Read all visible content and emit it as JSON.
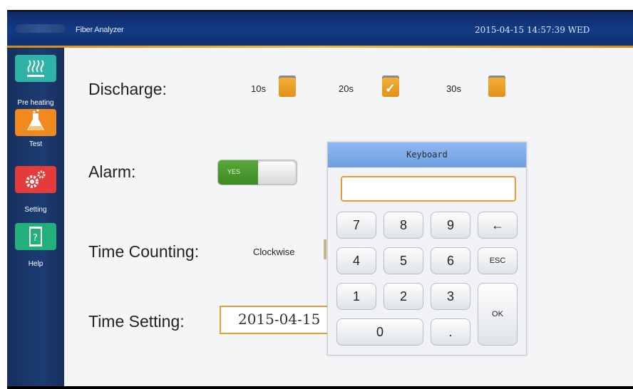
{
  "header": {
    "app_title": "Fiber Analyzer",
    "datetime": "2015-04-15  14:57:39  WED"
  },
  "sidebar": {
    "items": [
      {
        "label": "Pre heating",
        "icon": "heater-icon",
        "color": "#2fb3a7"
      },
      {
        "label": "Test",
        "icon": "flask-icon",
        "color": "#f08a1e"
      },
      {
        "label": "Setting",
        "icon": "gear-icon",
        "color": "#e53b3b"
      },
      {
        "label": "Help",
        "icon": "help-book-icon",
        "color": "#22b07a"
      }
    ]
  },
  "settings": {
    "discharge": {
      "label": "Discharge:",
      "options": [
        {
          "label": "10s",
          "checked": false
        },
        {
          "label": "20s",
          "checked": true
        },
        {
          "label": "30s",
          "checked": false
        }
      ]
    },
    "alarm": {
      "label": "Alarm:",
      "toggle_label": "YES",
      "on": true
    },
    "time_counting": {
      "label": "Time Counting:",
      "option": "Clockwise"
    },
    "time_setting": {
      "label": "Time Setting:",
      "value": "2015-04-15"
    }
  },
  "keyboard": {
    "title": "Keyboard",
    "input_value": "",
    "keys": [
      "7",
      "8",
      "9",
      "←",
      "4",
      "5",
      "6",
      "ESC",
      "1",
      "2",
      "3",
      "OK",
      "0",
      "."
    ]
  },
  "colors": {
    "accent_orange": "#e59e36",
    "toggle_green": "#4a9a2f",
    "titlebar_blue": "#133b85",
    "keyboard_header": "#7ea9e8"
  }
}
